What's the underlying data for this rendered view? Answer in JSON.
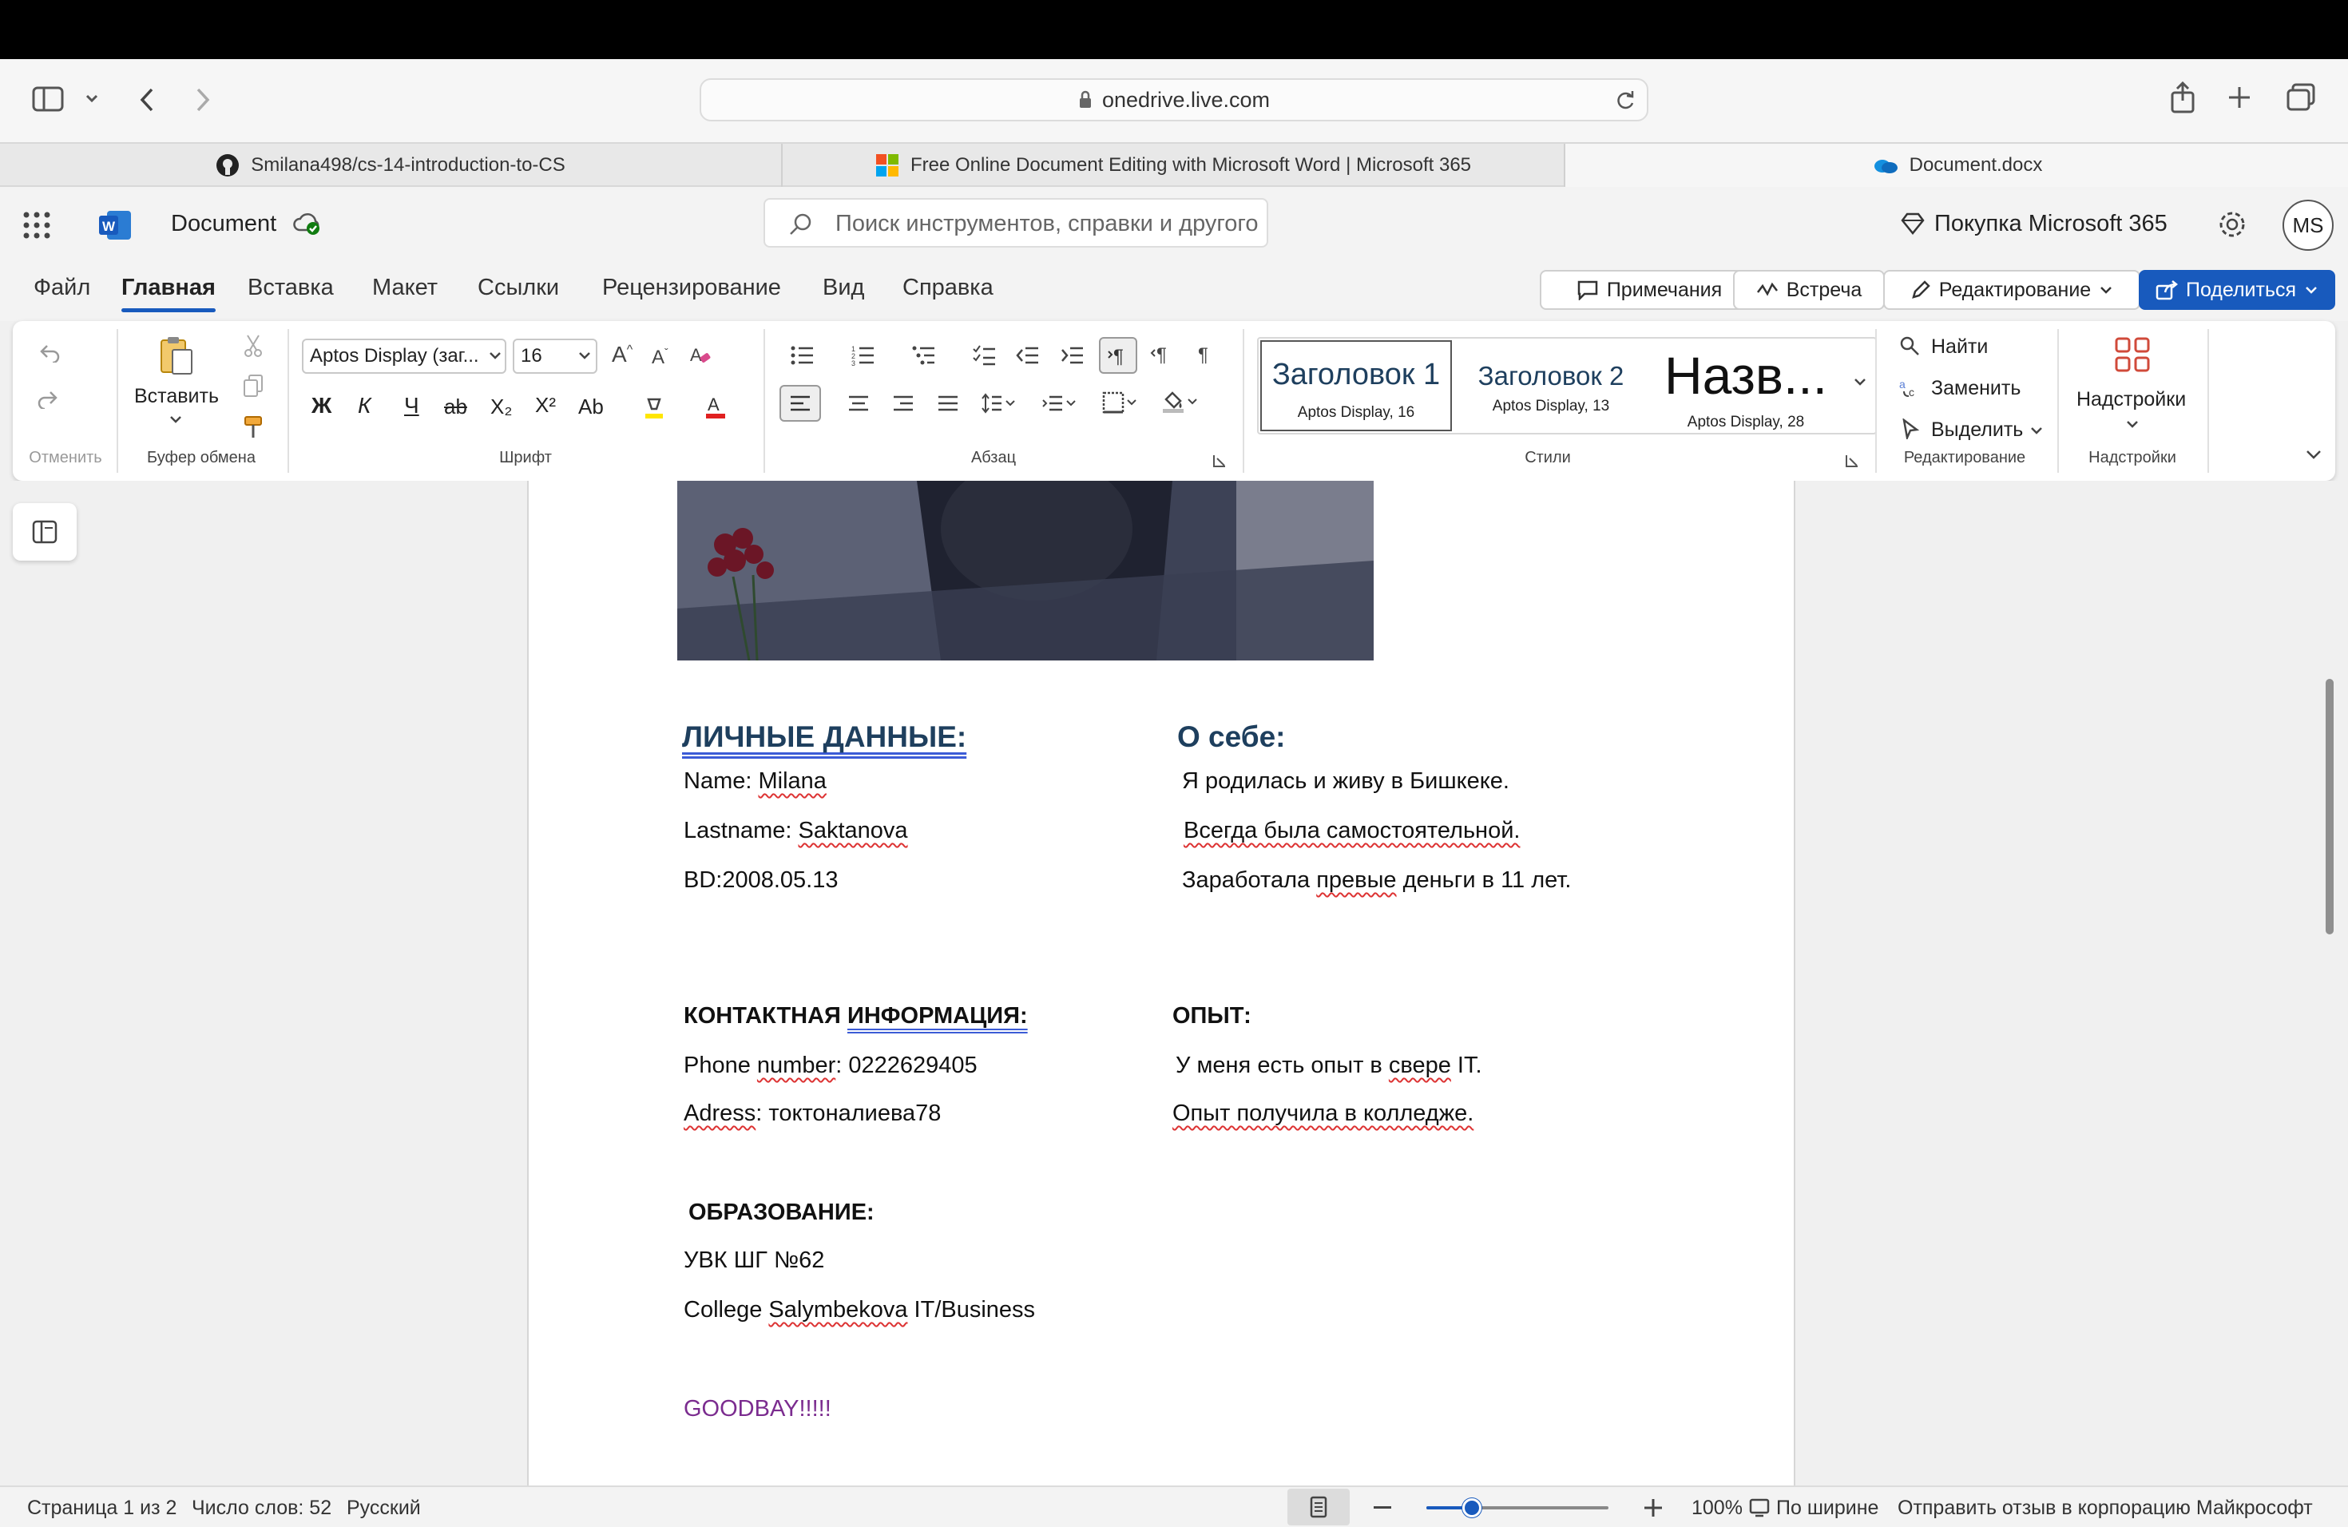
{
  "browser": {
    "url": "onedrive.live.com",
    "tabs": [
      {
        "label": "Smilana498/cs-14-introduction-to-CS",
        "icon": "github-icon"
      },
      {
        "label": "Free Online Document Editing with Microsoft Word | Microsoft 365",
        "icon": "microsoft-logo-icon"
      },
      {
        "label": "Document.docx",
        "icon": "onedrive-icon"
      }
    ]
  },
  "word": {
    "doc_title": "Document",
    "search_placeholder": "Поиск инструментов, справки и другого",
    "buy_label": "Покупка Microsoft 365",
    "avatar": "MS",
    "menu": [
      "Файл",
      "Главная",
      "Вставка",
      "Макет",
      "Ссылки",
      "Рецензирование",
      "Вид",
      "Справка"
    ],
    "buttons": {
      "comments": "Примечания",
      "meeting": "Встреча",
      "editing": "Редактирование",
      "share": "Поделиться"
    }
  },
  "ribbon": {
    "undo_group": "Отменить",
    "clipboard_group": "Буфер обмена",
    "paste": "Вставить",
    "font_group": "Шрифт",
    "font_name": "Aptos Display (заг...",
    "font_size": "16",
    "bold": "Ж",
    "italic": "К",
    "underline": "Ч",
    "strike": "ab",
    "sub": "X₂",
    "sup": "X²",
    "case": "Ab",
    "paragraph_group": "Абзац",
    "styles_group": "Стили",
    "styles": [
      {
        "name": "Заголовок 1",
        "desc": "Aptos Display, 16"
      },
      {
        "name": "Заголовок 2",
        "desc": "Aptos Display, 13"
      },
      {
        "name": "Назв...",
        "desc": "Aptos Display, 28"
      }
    ],
    "editing_group": "Редактирование",
    "find": "Найти",
    "replace": "Заменить",
    "select": "Выделить",
    "addins_group": "Надстройки",
    "addins": "Надстройки"
  },
  "document": {
    "personal_heading": "ЛИЧНЫЕ ДАННЫЕ:",
    "about_heading": "О себе:",
    "name_label": "Name: ",
    "name_value": "Milana",
    "lastname_label": "Lastname: ",
    "lastname_value": "Saktanova",
    "bd": "BD:2008.05.13",
    "about_1": "Я родилась и живу в Бишкеке.",
    "about_2": "Всегда была самостоятельной.",
    "about_3a": "Заработала ",
    "about_3b": "превые",
    "about_3c": " деньги в 11 лет.",
    "contact_heading_a": "КОНТАКТНАЯ ",
    "contact_heading_b": "ИНФОРМАЦИЯ:",
    "experience_heading": "ОПЫТ:",
    "phone_a": "Phone ",
    "phone_b": "number",
    "phone_c": ": 0222629405",
    "address_a": "Adress",
    "address_b": ": токтоналиева78",
    "exp_1a": "У меня есть опыт в ",
    "exp_1b": "свере",
    "exp_1c": " IT.",
    "exp_2": "Опыт получила в колледже.",
    "education_heading": "ОБРАЗОВАНИЕ:",
    "edu_1": "УВК ШГ №62",
    "edu_2a": "College ",
    "edu_2b": "Salymbekova",
    "edu_2c": " IT/Business",
    "goodbye": "GOODBAY!!!!!",
    "goodbye_color": "#7b2c8f"
  },
  "status": {
    "page": "Страница 1 из 2",
    "words": "Число слов: 52",
    "language": "Русский",
    "zoom": "100%",
    "fit": "По ширине",
    "feedback": "Отправить отзыв в корпорацию Майкрософт",
    "zoom_slider_fraction": 0.25
  },
  "colors": {
    "accent": "#185abd",
    "heading": "#1e3f5e",
    "word_blue": "#185abd"
  }
}
